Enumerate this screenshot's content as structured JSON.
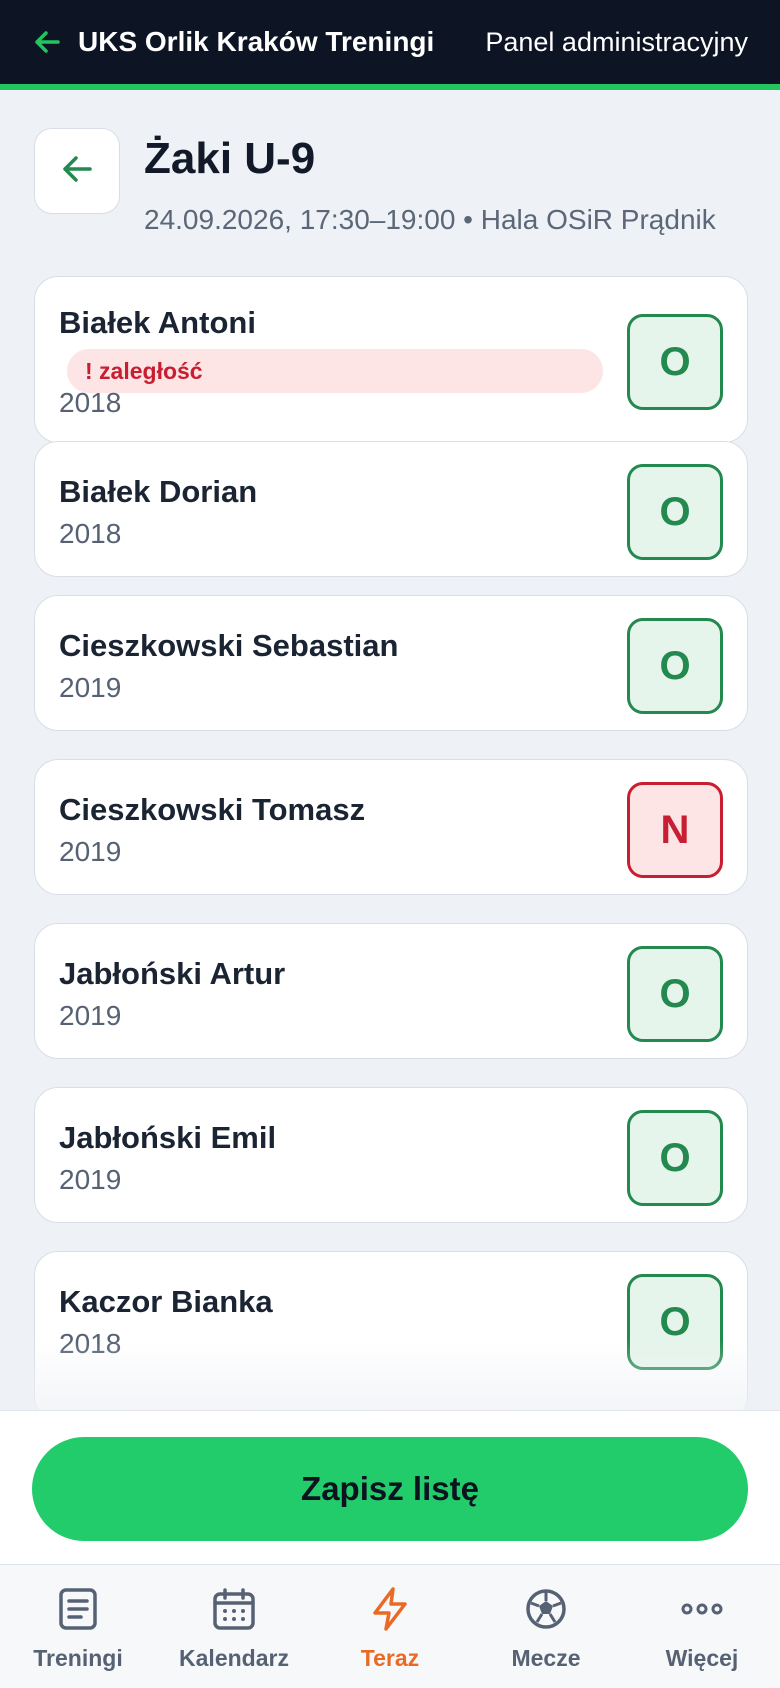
{
  "topbar": {
    "title": "UKS Orlik Kraków Treningi",
    "admin_label": "Panel administracyjny"
  },
  "session": {
    "title": "Żaki U-9",
    "subtitle": "24.09.2026, 17:30–19:00 • Hala OSiR Prądnik"
  },
  "players": [
    {
      "name": "Białek Antoni",
      "badge": "! zaległość",
      "year": "2018",
      "status": "O"
    },
    {
      "name": "Białek Dorian",
      "year": "2018",
      "status": "O"
    },
    {
      "name": "Cieszkowski Sebastian",
      "year": "2019",
      "status": "O"
    },
    {
      "name": "Cieszkowski Tomasz",
      "year": "2019",
      "status": "N"
    },
    {
      "name": "Jabłoński Artur",
      "year": "2019",
      "status": "O"
    },
    {
      "name": "Jabłoński Emil",
      "year": "2019",
      "status": "O"
    },
    {
      "name": "Kaczor Bianka",
      "year": "2018",
      "status": "O"
    }
  ],
  "save_label": "Zapisz listę",
  "nav": [
    {
      "label": "Treningi",
      "icon": "document-icon"
    },
    {
      "label": "Kalendarz",
      "icon": "calendar-icon"
    },
    {
      "label": "Teraz",
      "icon": "lightning-icon",
      "active": true
    },
    {
      "label": "Mecze",
      "icon": "soccer-ball-icon"
    },
    {
      "label": "Więcej",
      "icon": "more-dots-icon"
    }
  ],
  "colors": {
    "accent": "#22c55e",
    "present": "#23894f",
    "absent": "#c81e31",
    "active_nav": "#ea6a25",
    "topbar_bg": "#0d1424"
  }
}
